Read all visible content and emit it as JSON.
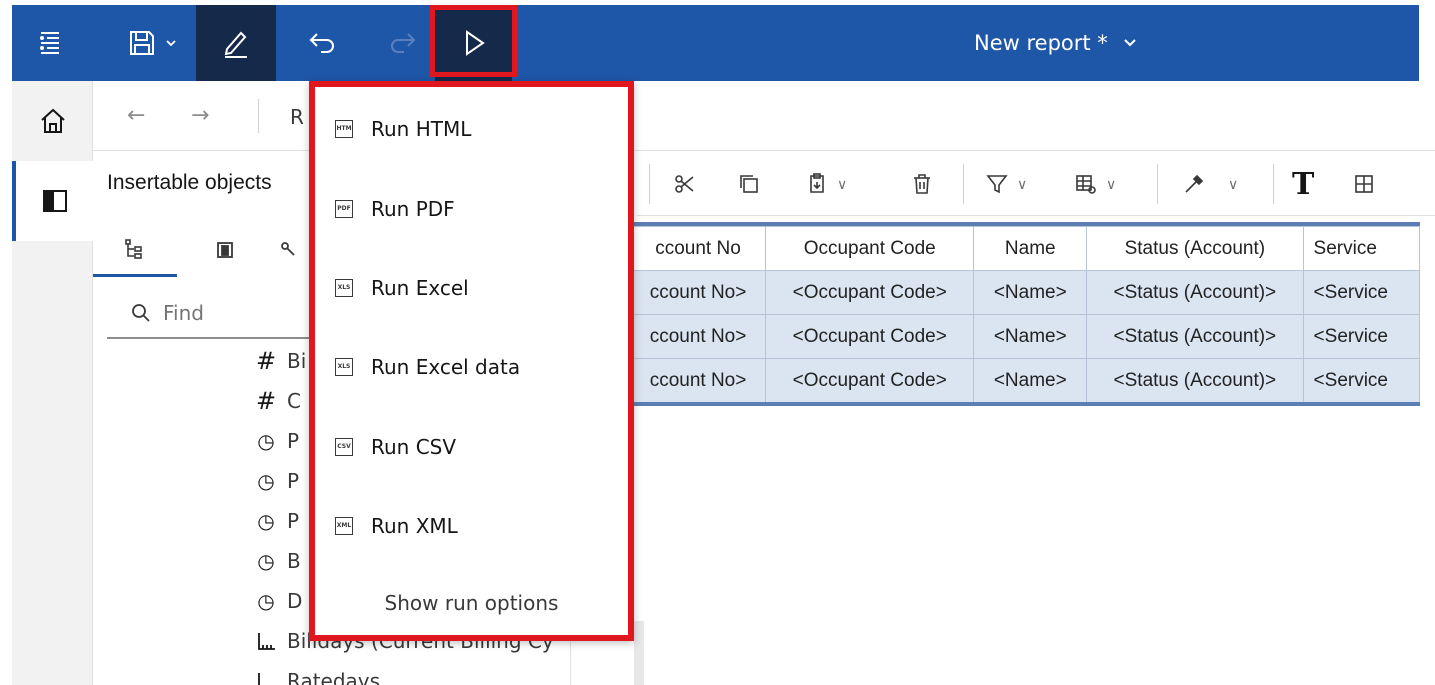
{
  "header": {
    "title": "New report *",
    "icons": [
      "menu-icon",
      "save-icon",
      "chevron-down-icon",
      "edit-pencil-icon",
      "undo-icon",
      "redo-icon",
      "run-play-icon"
    ]
  },
  "nav": {
    "back_glyph": "←",
    "forward_glyph": "→",
    "breadcrumb_partial": "R"
  },
  "panel": {
    "title": "Insertable objects",
    "search_placeholder": "Find",
    "tree": [
      {
        "glyph": "#",
        "label": "Bi",
        "icon": "number-icon"
      },
      {
        "glyph": "#",
        "label": "C",
        "icon": "number-icon"
      },
      {
        "glyph": "🕓",
        "label": "P",
        "icon": "clock-icon"
      },
      {
        "glyph": "🕓",
        "label": "P",
        "icon": "clock-icon"
      },
      {
        "glyph": "🕓",
        "label": "P",
        "icon": "clock-icon"
      },
      {
        "glyph": "🕓",
        "label": "B",
        "icon": "clock-icon"
      },
      {
        "glyph": "🕓",
        "label": "D",
        "icon": "clock-icon"
      },
      {
        "glyph": "⅃",
        "label": "Billdays (Current Billing Cy",
        "icon": "measure-icon"
      },
      {
        "glyph": "⅃",
        "label": "Ratedays",
        "icon": "measure-icon"
      }
    ]
  },
  "run_menu": {
    "items": [
      {
        "label": "Run HTML",
        "badge": "HTM",
        "icon": "html-file-icon"
      },
      {
        "label": "Run PDF",
        "badge": "PDF",
        "icon": "pdf-file-icon"
      },
      {
        "label": "Run Excel",
        "badge": "XLS",
        "icon": "excel-file-icon"
      },
      {
        "label": "Run Excel data",
        "badge": "XLS",
        "icon": "excel-data-file-icon"
      },
      {
        "label": "Run CSV",
        "badge": "CSV",
        "icon": "csv-file-icon"
      },
      {
        "label": "Run XML",
        "badge": "XML",
        "icon": "xml-file-icon"
      }
    ],
    "footer": "Show run options"
  },
  "toolbar": {
    "text_glyph": "T"
  },
  "table": {
    "headers": [
      "ccount No",
      "Occupant Code",
      "Name",
      "Status (Account)",
      "Service"
    ],
    "rows": [
      [
        "ccount No>",
        "<Occupant Code>",
        "<Name>",
        "<Status (Account)>",
        "<Service"
      ],
      [
        "ccount No>",
        "<Occupant Code>",
        "<Name>",
        "<Status (Account)>",
        "<Service"
      ],
      [
        "ccount No>",
        "<Occupant Code>",
        "<Name>",
        "<Status (Account)>",
        "<Service"
      ]
    ]
  },
  "colors": {
    "header_bg": "#1f57a8",
    "active_bg": "#15294a",
    "highlight": "#e0171f",
    "cell_bg": "#dbe4f1"
  }
}
